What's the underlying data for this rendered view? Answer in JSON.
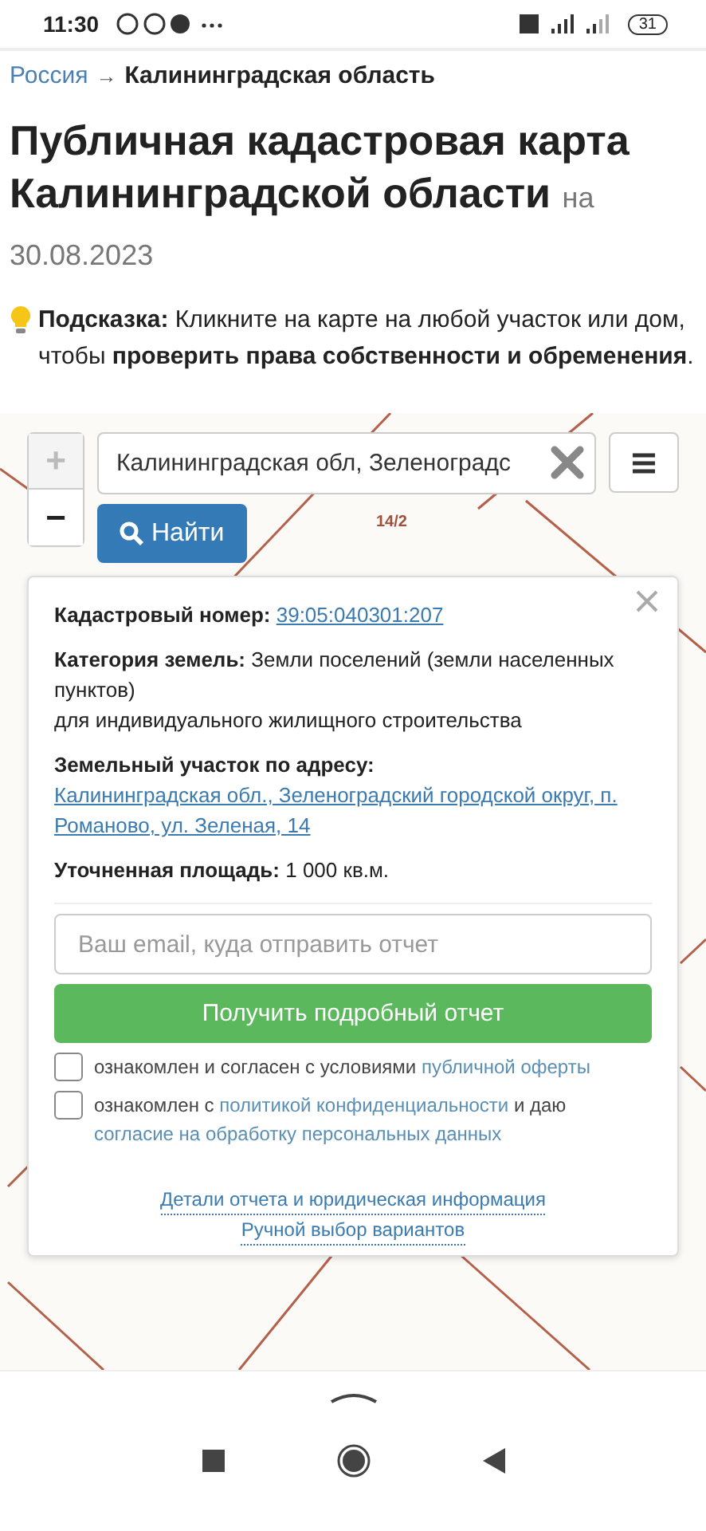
{
  "status_bar": {
    "time": "11:30",
    "battery": "31"
  },
  "breadcrumb": {
    "separator": "→",
    "items": [
      {
        "label": "Россия",
        "kind": "link"
      },
      {
        "label": "Калининградская область",
        "kind": "current"
      }
    ]
  },
  "title": "Публичная кадастровая карта Калининградской области",
  "title_suffix": "на 30.08.2023",
  "hint": "**Подсказка:** Кликните на карте на любой участок или дом, чтобы **проверить права собственности и обременения**.",
  "map": {
    "zoom_in": {
      "label": "+",
      "disabled": true
    },
    "zoom_out": {
      "label": "−",
      "disabled": false
    },
    "search_value": "Калининградская обл, Зеленоградс",
    "search_button": "Найти",
    "parcel_label": "14/2"
  },
  "popup": {
    "fields": [
      {
        "kind": "link",
        "label": "Кадастровый номер:",
        "value": "39:05:040301:207"
      },
      {
        "kind": "text",
        "label": "Категория земель:",
        "value": "Земли поселений (земли населенных пунктов)",
        "note": "для индивидуального жилищного строительства"
      },
      {
        "kind": "link",
        "label": "Земельный участок по адресу:",
        "value": "Калининградская обл., Зеленоградский городской округ, п. Романово, ул. Зеленая, 14"
      },
      {
        "kind": "text",
        "label": "Уточненная площадь:",
        "value": "1 000 кв.м."
      }
    ],
    "email_placeholder": "Ваш email, куда отправить отчет",
    "submit": "Получить подробный отчет",
    "consents": [
      {
        "checked": false,
        "parts": [
          {
            "text": "ознакомлен и согласен с условиями",
            "link": false
          },
          {
            "text": "публичной оферты",
            "link": true
          }
        ]
      },
      {
        "checked": false,
        "parts": [
          {
            "text": "ознакомлен с",
            "link": false
          },
          {
            "text": "политикой конфиденциальности",
            "link": true
          },
          {
            "text": "и даю",
            "link": false
          },
          {
            "text": "согласие на обработку персональных данных",
            "link": true
          }
        ]
      }
    ],
    "footer_links": [
      "Детали отчета и юридическая информация",
      "Ручной выбор вариантов"
    ]
  }
}
